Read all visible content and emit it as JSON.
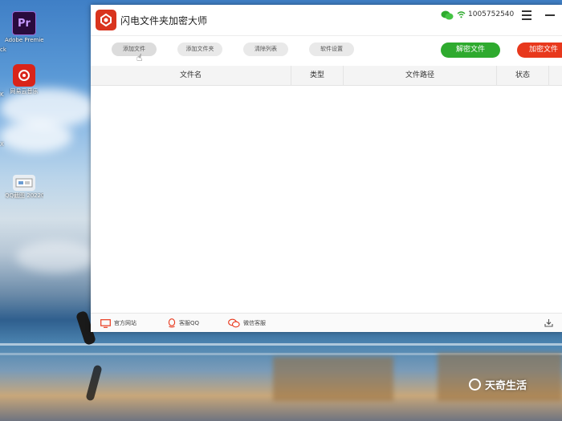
{
  "desktop": {
    "icons": [
      {
        "label": "Adobe Premie...",
        "glyph": "Pr",
        "bg": "#2a0b3d",
        "fg": "#c79bff"
      },
      {
        "label": "网易云音乐",
        "glyph": "",
        "bg": "#d9241a",
        "fg": "#ffffff"
      },
      {
        "label": "QQ截图 2022082...",
        "glyph": "",
        "bg": "#e9eef3",
        "fg": "#333333"
      }
    ],
    "edge_chars": [
      "ck",
      "K",
      "X"
    ]
  },
  "window": {
    "title": "闪电文件夹加密大师",
    "account": "1005752540",
    "toolbar": {
      "add_file": "添加文件",
      "add_folder": "添加文件夹",
      "clear_list": "清除列表",
      "settings": "软件设置",
      "decrypt": "解密文件",
      "encrypt": "加密文件"
    },
    "columns": {
      "filename": "文件名",
      "type": "类型",
      "path": "文件路径",
      "status": "状态"
    },
    "footer": {
      "website": "官方网站",
      "qq_support": "客服QQ",
      "wechat_support": "微信客服"
    },
    "colors": {
      "accent_green": "#2eaa2e",
      "accent_red": "#e8381c",
      "logo": "#d9341e"
    }
  },
  "watermark": "天奇生活"
}
